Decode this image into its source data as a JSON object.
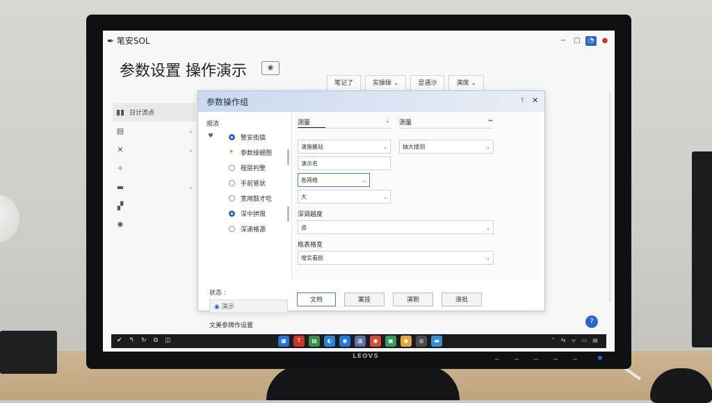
{
  "monitor": {
    "brand": "LEOVS"
  },
  "window": {
    "app_name": "笔安SOL",
    "page_title": "参数设置 操作演示",
    "controls": [
      "−",
      "□",
      "◔",
      "●"
    ]
  },
  "topbar": {
    "buttons": [
      {
        "label": "笔记了",
        "chevron": ""
      },
      {
        "label": "实操操 ⌄",
        "chevron": ""
      },
      {
        "label": "显通沙",
        "chevron": ""
      },
      {
        "label": "演席 ⌄",
        "chevron": ""
      }
    ]
  },
  "sidebar": {
    "items": [
      {
        "icon": "▮▮",
        "label": "日计流点",
        "chevron": ""
      },
      {
        "icon": "▤",
        "label": "",
        "chevron": "⌄"
      },
      {
        "icon": "✕",
        "label": "",
        "chevron": "⌄"
      },
      {
        "icon": "✧",
        "label": "",
        "chevron": ""
      },
      {
        "icon": "▬",
        "label": "",
        "chevron": "⌄"
      },
      {
        "icon": "▞",
        "label": "",
        "chevron": ""
      },
      {
        "icon": "✺",
        "label": "",
        "chevron": ""
      }
    ]
  },
  "dialog": {
    "title": "参数操作组",
    "pin_icon": "⫯",
    "close_icon": "✕",
    "left_label": "观浓",
    "left_arrow": "♥",
    "options": [
      {
        "state": "on",
        "label": "警安街搞"
      },
      {
        "state": "icon",
        "label": "参数操据图"
      },
      {
        "state": "off",
        "label": "程层判警"
      },
      {
        "state": "off",
        "label": "手前管状"
      },
      {
        "state": "off",
        "label": "宽用鼓才吃"
      },
      {
        "state": "on",
        "label": "深中拱限"
      },
      {
        "state": "off",
        "label": "深递格源"
      }
    ],
    "col1_header": "测量",
    "col2_header": "测量",
    "col2_extra": "↔",
    "fields": {
      "col1_row1": "演施搬站",
      "col1_row2": "演示名",
      "col1_row3": "各网络",
      "col1_row4": "大",
      "col2_row1": "抽大搜测"
    },
    "wide_label_1": "深调越度",
    "wide_field_1": "卤",
    "wide_label_2": "瓶表格变",
    "wide_field_2": "嗖实看剧",
    "buttons": [
      "文档",
      "案技",
      "演新",
      "淮批"
    ]
  },
  "status": {
    "label": "状态 :",
    "field": "演示",
    "footer": "文美参牌作设置"
  },
  "help_icon": "?",
  "taskbar": {
    "left": [
      "✔",
      "↰",
      "↻",
      "⧉",
      "◫"
    ],
    "apps": [
      {
        "glyph": "▦",
        "color": "#2a6fd1"
      },
      {
        "glyph": "T",
        "color": "#c8352b"
      },
      {
        "glyph": "▤",
        "color": "#3c8d4a"
      },
      {
        "glyph": "◐",
        "color": "#2b7fd4"
      },
      {
        "glyph": "◉",
        "color": "#1f7ad8"
      },
      {
        "glyph": "▥",
        "color": "#5d6ea5"
      },
      {
        "glyph": "◉",
        "color": "#d94a3a"
      },
      {
        "glyph": "▣",
        "color": "#2f9e57"
      },
      {
        "glyph": "◉",
        "color": "#e0a73a"
      },
      {
        "glyph": "◎",
        "color": "#4a4c52"
      },
      {
        "glyph": "▬",
        "color": "#3b8ed6"
      }
    ],
    "right": [
      "⌃",
      "⇆",
      "ᯤ",
      "▭",
      "▤"
    ]
  }
}
